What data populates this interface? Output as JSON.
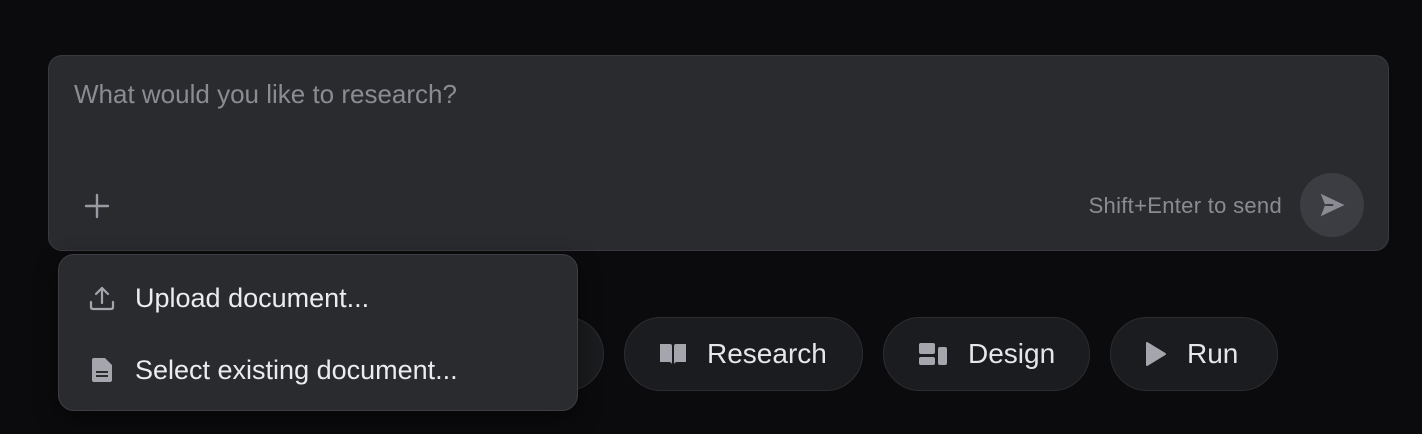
{
  "composer": {
    "placeholder": "What would you like to research?",
    "value": "",
    "hint": "Shift+Enter to send",
    "add_icon": "plus-icon",
    "send_icon": "send-icon"
  },
  "attach_menu": {
    "items": [
      {
        "label": "Upload document...",
        "icon": "upload-icon"
      },
      {
        "label": "Select existing document...",
        "icon": "document-icon"
      }
    ]
  },
  "chips": [
    {
      "label": "Research",
      "icon": "book-icon"
    },
    {
      "label": "Design",
      "icon": "layout-icon"
    },
    {
      "label": "Run",
      "icon": "play-icon"
    }
  ],
  "colors": {
    "background": "#0b0b0d",
    "panel": "#2a2b2f",
    "chip": "#1b1c1f",
    "text": "#e6e6ea",
    "muted": "#8b8c93",
    "send_button": "#3c3d42"
  }
}
